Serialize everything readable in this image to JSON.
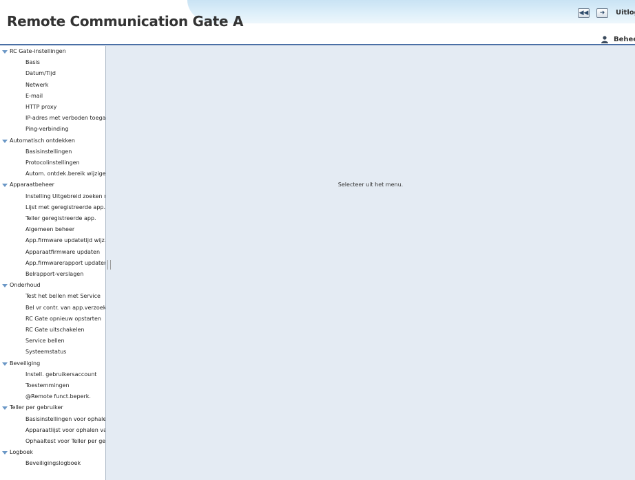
{
  "header": {
    "title": "Remote Communication Gate A",
    "logout_label": "Uitlogg",
    "user_label": "Beheerd",
    "back_icon": "back-icon",
    "forward_icon": "logout-arrow-icon"
  },
  "main": {
    "message": "Selecteer uit het menu."
  },
  "sidebar": {
    "categories": [
      {
        "label": "RC Gate-instellingen",
        "items": [
          "Basis",
          "Datum/Tijd",
          "Netwerk",
          "E-mail",
          "HTTP proxy",
          "IP-adres met verboden toegang",
          "Ping-verbinding"
        ]
      },
      {
        "label": "Automatisch ontdekken",
        "items": [
          "Basisinstellingen",
          "Protocolinstellingen",
          "Autom. ontdek.bereik wijzigen"
        ]
      },
      {
        "label": "Apparaatbeheer",
        "items": [
          "Instelling Uitgebreid zoeken naar",
          "Lijst met geregistreerde app.",
          "Teller geregistreerde app.",
          "Algemeen beheer",
          "App.firmware updatetijd wijz.",
          "Apparaatfirmware updaten",
          "App.firmwarerapport updaten",
          "Belrapport-verslagen"
        ]
      },
      {
        "label": "Onderhoud",
        "items": [
          "Test het bellen met Service",
          "Bel vr contr. van app.verzoek",
          "RC Gate opnieuw opstarten",
          "RC Gate uitschakelen",
          "Service bellen",
          "Systeemstatus"
        ]
      },
      {
        "label": "Beveiliging",
        "items": [
          "Instell. gebruikersaccount",
          "Toestemmingen",
          "@Remote funct.beperk."
        ]
      },
      {
        "label": "Teller per gebruiker",
        "items": [
          "Basisinstellingen voor ophalen va",
          "Apparaatlijst voor ophalen van Te",
          "Ophaaltest voor Teller per gebrui"
        ]
      },
      {
        "label": "Logboek",
        "items": [
          "Beveiligingslogboek"
        ]
      }
    ]
  }
}
